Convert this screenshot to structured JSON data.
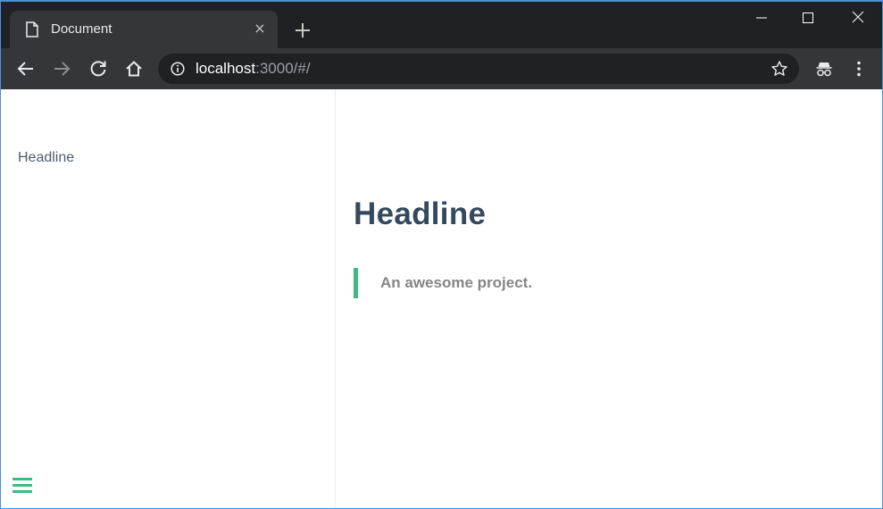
{
  "browser": {
    "tab": {
      "title": "Document",
      "close_glyph": "×",
      "favicon": "document-icon"
    },
    "window_controls": [
      "minimize-icon",
      "maximize-icon",
      "close-icon"
    ],
    "toolbar": {
      "url_host": "localhost",
      "url_rest": ":3000/#/",
      "icons": [
        "back-icon",
        "forward-icon",
        "reload-icon",
        "home-icon",
        "info-icon",
        "bookmark-star-icon",
        "incognito-icon",
        "menu-dots-icon"
      ]
    }
  },
  "sidebar": {
    "items": [
      {
        "label": "Headline"
      }
    ],
    "menu_icon": "hamburger-icon"
  },
  "main": {
    "heading": "Headline",
    "blockquote": "An awesome project."
  },
  "colors": {
    "accent": "#42b983",
    "heading": "#34495e",
    "sidebar_text": "#505d6b",
    "quote_text": "#858585",
    "browser_dark": "#202124",
    "browser_toolbar": "#35363a"
  }
}
